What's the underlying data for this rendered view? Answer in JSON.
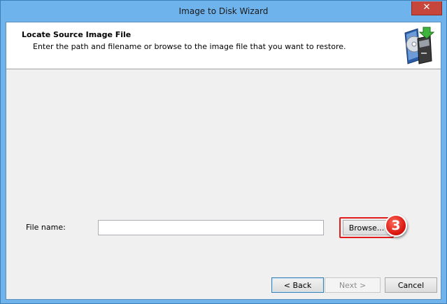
{
  "window": {
    "title": "Image to Disk Wizard",
    "close_glyph": "✕"
  },
  "header": {
    "title": "Locate Source Image File",
    "description": "Enter the path and filename or browse to the image file that you want to restore.",
    "icon": "disk-image-restore-icon"
  },
  "form": {
    "file_label": "File name:",
    "file_value": "",
    "browse_label": "Browse...",
    "step_number": "3"
  },
  "footer": {
    "back_label": "< Back",
    "next_label": "Next >",
    "cancel_label": "Cancel"
  },
  "colors": {
    "title_bar": "#6fb3ec",
    "close_button": "#c7463b",
    "highlight": "#e01c1c"
  }
}
